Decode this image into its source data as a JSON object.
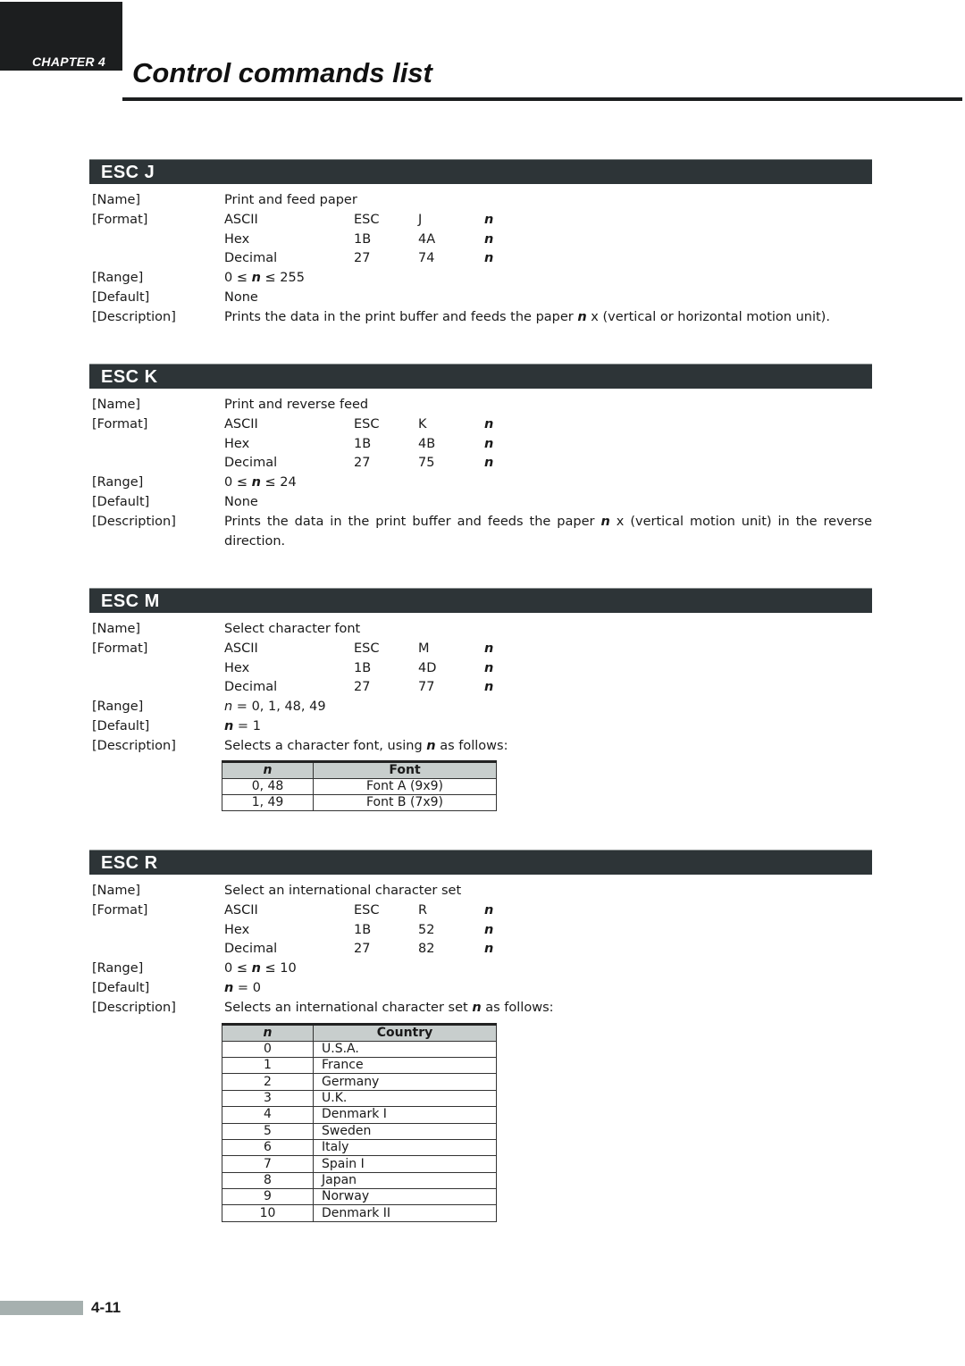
{
  "header": {
    "chapter": "CHAPTER 4",
    "title": "Control commands list"
  },
  "labels": {
    "name": "[Name]",
    "format": "[Format]",
    "range": "[Range]",
    "default": "[Default]",
    "description": "[Description]"
  },
  "sections": [
    {
      "title": "ESC J",
      "name": "Print and feed paper",
      "format": [
        {
          "type": "ASCII",
          "b1": "ESC",
          "b2": "J",
          "p": "n"
        },
        {
          "type": "Hex",
          "b1": "1B",
          "b2": "4A",
          "p": "n"
        },
        {
          "type": "Decimal",
          "b1": "27",
          "b2": "74",
          "p": "n"
        }
      ],
      "range": {
        "pre": "0 ≤ ",
        "n": "n",
        "post": " ≤ 255"
      },
      "default": "None",
      "description": {
        "pre": "Prints the data in the print buffer and feeds the paper ",
        "n": "n",
        "post": " x (vertical or horizontal motion unit)."
      }
    },
    {
      "title": "ESC K",
      "name": "Print and reverse feed",
      "format": [
        {
          "type": "ASCII",
          "b1": "ESC",
          "b2": "K",
          "p": "n"
        },
        {
          "type": "Hex",
          "b1": "1B",
          "b2": "4B",
          "p": "n"
        },
        {
          "type": "Decimal",
          "b1": "27",
          "b2": "75",
          "p": "n"
        }
      ],
      "range": {
        "pre": "0 ≤ ",
        "n": "n",
        "post": " ≤ 24"
      },
      "default": "None",
      "description": {
        "pre": "Prints the data in the print buffer and feeds the paper ",
        "n": "n",
        "post": " x (vertical motion unit) in the reverse direction."
      }
    },
    {
      "title": "ESC M",
      "name": "Select character font",
      "format": [
        {
          "type": "ASCII",
          "b1": "ESC",
          "b2": "M",
          "p": "n"
        },
        {
          "type": "Hex",
          "b1": "1B",
          "b2": "4D",
          "p": "n"
        },
        {
          "type": "Decimal",
          "b1": "27",
          "b2": "77",
          "p": "n"
        }
      ],
      "range": {
        "pre": "",
        "n": "n",
        "post": " = 0, 1, 48, 49"
      },
      "default": {
        "n": "n",
        "post": " = 1"
      },
      "description": {
        "pre": "Selects a character font, using ",
        "n": "n",
        "post": " as follows:"
      },
      "table": {
        "headers": [
          "n",
          "Font"
        ],
        "rows": [
          [
            "0, 48",
            "Font A (9x9)"
          ],
          [
            "1, 49",
            "Font B (7x9)"
          ]
        ]
      }
    },
    {
      "title": "ESC R",
      "name": "Select an international character set",
      "format": [
        {
          "type": "ASCII",
          "b1": "ESC",
          "b2": "R",
          "p": "n"
        },
        {
          "type": "Hex",
          "b1": "1B",
          "b2": "52",
          "p": "n"
        },
        {
          "type": "Decimal",
          "b1": "27",
          "b2": "82",
          "p": "n"
        }
      ],
      "range": {
        "pre": "0 ≤ ",
        "n": "n",
        "post": " ≤ 10"
      },
      "default": {
        "n": "n",
        "post": " = 0"
      },
      "description": {
        "pre": "Selects an international character set ",
        "n": "n",
        "post": " as follows:"
      },
      "table": {
        "headers": [
          "n",
          "Country"
        ],
        "rows": [
          [
            "0",
            "U.S.A."
          ],
          [
            "1",
            "France"
          ],
          [
            "2",
            "Germany"
          ],
          [
            "3",
            "U.K."
          ],
          [
            "4",
            "Denmark I"
          ],
          [
            "5",
            "Sweden"
          ],
          [
            "6",
            "Italy"
          ],
          [
            "7",
            "Spain I"
          ],
          [
            "8",
            "Japan"
          ],
          [
            "9",
            "Norway"
          ],
          [
            "10",
            "Denmark II"
          ]
        ]
      }
    }
  ],
  "footer": {
    "page_number": "4-11"
  }
}
